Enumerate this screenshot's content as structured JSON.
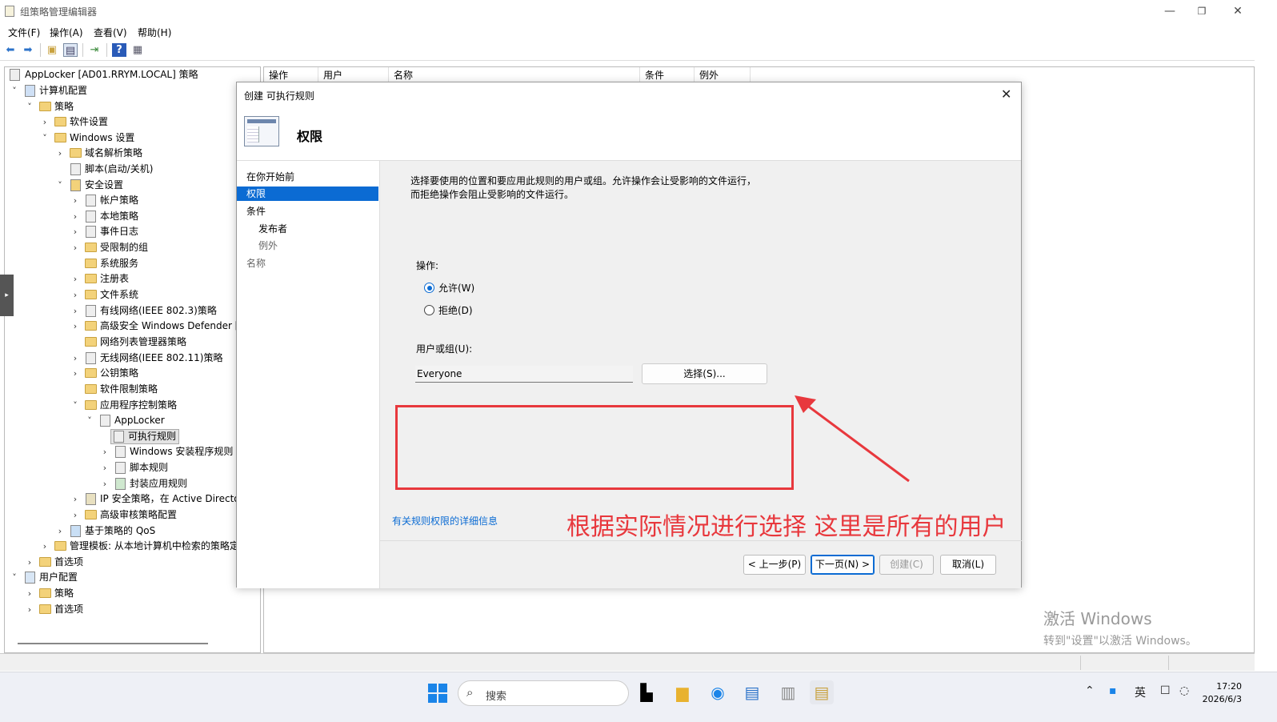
{
  "window": {
    "title": "组策略管理编辑器"
  },
  "menu": [
    "文件(F)",
    "操作(A)",
    "查看(V)",
    "帮助(H)"
  ],
  "tree": {
    "root": "AppLocker [AD01.RRYM.LOCAL] 策略",
    "computer_config": "计算机配置",
    "policies": "策略",
    "software_settings": "软件设置",
    "windows_settings": "Windows 设置",
    "dns_policy": "域名解析策略",
    "scripts": "脚本(启动/关机)",
    "security_settings": "安全设置",
    "account_policy": "帐户策略",
    "local_policy": "本地策略",
    "event_log": "事件日志",
    "restricted_groups": "受限制的组",
    "system_services": "系统服务",
    "registry": "注册表",
    "file_system": "文件系统",
    "wired_network": "有线网络(IEEE 802.3)策略",
    "defender_firewall": "高级安全 Windows Defender 防",
    "network_list": "网络列表管理器策略",
    "wireless_network": "无线网络(IEEE 802.11)策略",
    "public_key": "公钥策略",
    "software_restriction": "软件限制策略",
    "app_control": "应用程序控制策略",
    "applocker": "AppLocker",
    "exe_rules": "可执行规则",
    "installer_rules": "Windows 安装程序规则",
    "script_rules": "脚本规则",
    "packaged_rules": "封装应用规则",
    "ip_security": "IP 安全策略，在 Active Director",
    "audit_policy": "高级审核策略配置",
    "qos": "基于策略的 QoS",
    "admin_templates": "管理模板: 从本地计算机中检索的策略定",
    "preferences": "首选项",
    "user_config": "用户配置",
    "user_policies": "策略",
    "user_preferences": "首选项"
  },
  "columns": [
    "操作",
    "用户",
    "名称",
    "条件",
    "例外"
  ],
  "dialog": {
    "title": "创建 可执行规则",
    "heading": "权限",
    "steps": [
      "在你开始前",
      "权限",
      "条件",
      "发布者",
      "例外",
      "名称"
    ],
    "description_line1": "选择要使用的位置和要应用此规则的用户或组。允许操作会让受影响的文件运行，",
    "description_line2": "而拒绝操作会阻止受影响的文件运行。",
    "action_label": "操作:",
    "allow_label": "允许(W)",
    "deny_label": "拒绝(D)",
    "selected_action": "允许(W)",
    "user_group_label": "用户或组(U):",
    "user_group_value": "Everyone",
    "select_button": "选择(S)...",
    "more_info_link": "有关规则权限的详细信息",
    "annotation": "根据实际情况进行选择 这里是所有的用户",
    "btn_prev": "< 上一步(P)",
    "btn_next": "下一页(N) >",
    "btn_create": "创建(C)",
    "btn_cancel": "取消(L)"
  },
  "watermark": {
    "line1": "激活 Windows",
    "line2": "转到\"设置\"以激活 Windows。"
  },
  "taskbar": {
    "search_placeholder": "搜索",
    "time": "17:20",
    "date": "2026/6/3",
    "ime": "英"
  },
  "colors": {
    "accent": "#0b6bd3",
    "annotation": "#e8383d"
  }
}
